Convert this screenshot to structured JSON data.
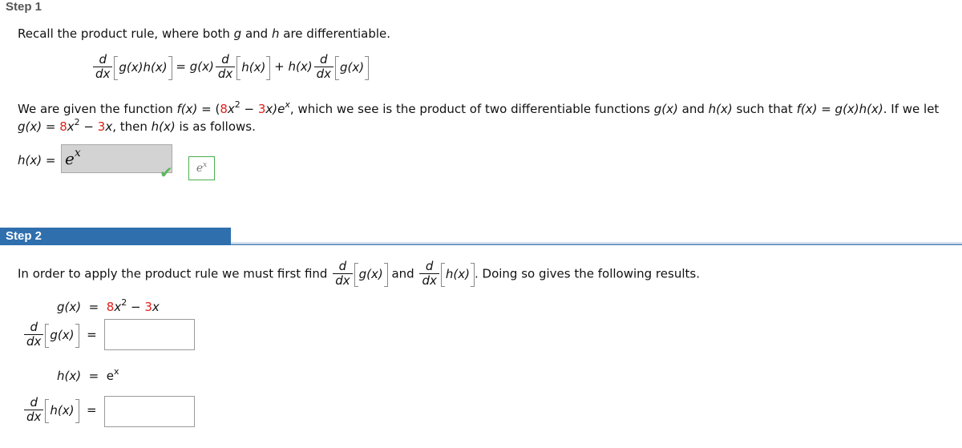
{
  "step1": {
    "title": "Step 1",
    "intro": {
      "prefix": "Recall the product rule, where both ",
      "g": "g",
      "and": " and ",
      "h": "h",
      "suffix": " are differentiable."
    },
    "product_rule": {
      "d": "d",
      "dx": "dx",
      "lhs_arg": "g(x)h(x)",
      "eq": "=",
      "term1_coef": "g(x)",
      "term1_arg": "h(x)",
      "plus": "+",
      "term2_coef": "h(x)",
      "term2_arg": "g(x)"
    },
    "given": {
      "line1_a": "We are given the function ",
      "fx": "f(x)",
      "eq": " = (",
      "coef1": "8",
      "x2": "x",
      "exp2": "2",
      "minus": " − ",
      "coef2": "3",
      "x_after": "x)e",
      "exp_x": "x",
      "line1_b": ", which we see is the product of two differentiable functions ",
      "gx": "g(x)",
      "and": " and ",
      "hx": "h(x)",
      "such": " such that ",
      "fx2": "f(x)",
      "eq2": " = ",
      "gxhx": "g(x)h(x)",
      "iflet": ". If we let",
      "line2_gx": "g(x)",
      "line2_eq": " = ",
      "line2_coef1": "8",
      "line2_x": "x",
      "line2_exp": "2",
      "line2_minus": " − ",
      "line2_coef2": "3",
      "line2_xend": "x",
      "line2_rest": ", then ",
      "line2_hx": "h(x)",
      "line2_tail": " is as follows."
    },
    "answer": {
      "label": "h(x)",
      "eq": "=",
      "value_base": "e",
      "value_exp": "x",
      "status": "correct",
      "preview_base": "e",
      "preview_exp": "x"
    }
  },
  "step2": {
    "title": "Step 2",
    "intro": {
      "prefix": "In order to apply the product rule we must first find ",
      "d": "d",
      "dx": "dx",
      "arg1": "g(x)",
      "and": " and ",
      "arg2": "h(x)",
      "suffix": ". Doing so gives the following results."
    },
    "g_def": {
      "label": "g(x)",
      "eq": "=",
      "coef1": "8",
      "x": "x",
      "exp": "2",
      "minus": " − ",
      "coef2": "3",
      "xend": "x"
    },
    "g_deriv": {
      "d": "d",
      "dx": "dx",
      "arg": "g(x)",
      "eq": "=",
      "value": ""
    },
    "h_def": {
      "label": "h(x)",
      "eq": "=",
      "base": "e",
      "exp": "x"
    },
    "h_deriv": {
      "d": "d",
      "dx": "dx",
      "arg": "h(x)",
      "eq": "=",
      "value": ""
    }
  },
  "colors": {
    "highlight": "#e0201a",
    "step_bar": "#2f6fad",
    "check": "#5cb85c"
  }
}
